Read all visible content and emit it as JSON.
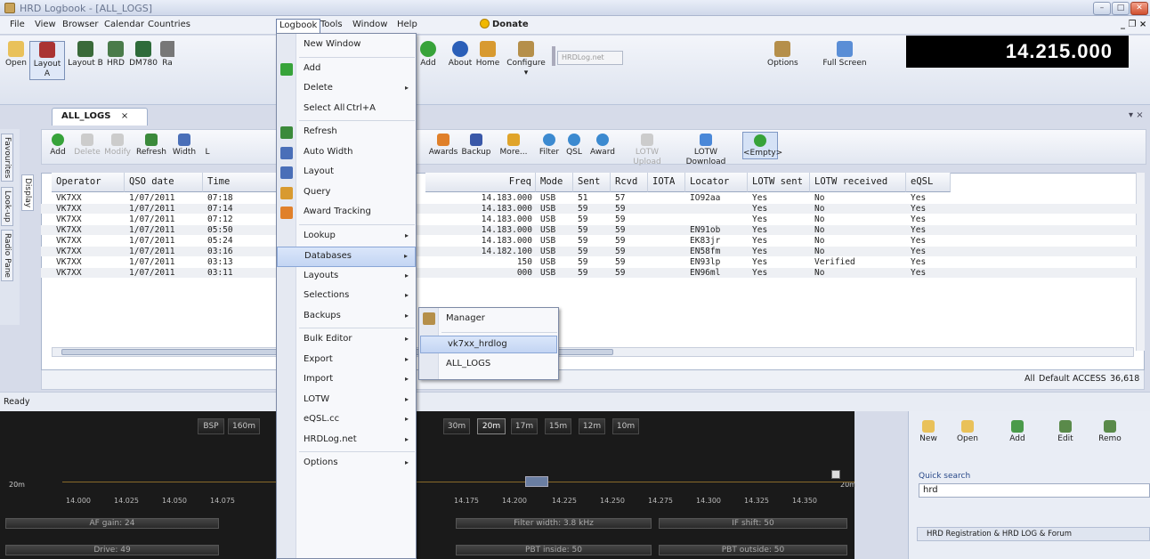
{
  "window": {
    "title": "HRD Logbook - [ALL_LOGS]",
    "min": "–",
    "max": "□",
    "close": "✕"
  },
  "menubar": {
    "items": [
      "File",
      "View",
      "Browser",
      "Calendar",
      "Countries",
      "Logbook",
      "Tools",
      "Window",
      "Help"
    ],
    "donate": "Donate",
    "mdi_controls": "_ ❐ ×"
  },
  "toolbar": {
    "buttons": [
      "Open",
      "Layout A",
      "Layout B",
      "HRD",
      "DM780",
      "Ra",
      "Add",
      "About",
      "Home",
      "Configure",
      "Options",
      "Full Screen"
    ],
    "hrdlog_placeholder": "HRDLog.net",
    "configure_arrow": "▾",
    "frequency": "14.215.000"
  },
  "document_tab": {
    "label": "ALL_LOGS",
    "close": "×",
    "right_controls": "▾ ×"
  },
  "side_tabs": [
    "Favourites",
    "Look-up",
    "Radio Pane"
  ],
  "display_tab": "Display",
  "inner_toolbar": {
    "buttons": [
      "Add",
      "Delete",
      "Modify",
      "Refresh",
      "Width",
      "L",
      "Awards",
      "Backup",
      "More...",
      "Filter",
      "QSL",
      "Award",
      "LOTW Upload",
      "LOTW Download",
      "<Empty>"
    ]
  },
  "grid": {
    "headers": [
      "Operator",
      "QSO date",
      "Time",
      "Freq",
      "Mode",
      "Sent",
      "Rcvd",
      "IOTA",
      "Locator",
      "LOTW sent",
      "LOTW received",
      "eQSL"
    ],
    "rows": [
      [
        "VK7XX",
        "1/07/2011",
        "07:18",
        "14.183.000",
        "USB",
        "51",
        "57",
        "",
        "IO92aa",
        "Yes",
        "No",
        "Yes"
      ],
      [
        "VK7XX",
        "1/07/2011",
        "07:14",
        "14.183.000",
        "USB",
        "59",
        "59",
        "",
        "",
        "Yes",
        "No",
        "Yes"
      ],
      [
        "VK7XX",
        "1/07/2011",
        "07:12",
        "14.183.000",
        "USB",
        "59",
        "59",
        "",
        "",
        "Yes",
        "No",
        "Yes"
      ],
      [
        "VK7XX",
        "1/07/2011",
        "05:50",
        "14.183.000",
        "USB",
        "59",
        "59",
        "",
        "EN91ob",
        "Yes",
        "No",
        "Yes"
      ],
      [
        "VK7XX",
        "1/07/2011",
        "05:24",
        "14.183.000",
        "USB",
        "59",
        "59",
        "",
        "EK83jr",
        "Yes",
        "No",
        "Yes"
      ],
      [
        "VK7XX",
        "1/07/2011",
        "03:16",
        "14.182.100",
        "USB",
        "59",
        "59",
        "",
        "EN58fm",
        "Yes",
        "No",
        "Yes"
      ],
      [
        "VK7XX",
        "1/07/2011",
        "03:13",
        "150",
        "USB",
        "59",
        "59",
        "",
        "EN93lp",
        "Yes",
        "Verified",
        "Yes"
      ],
      [
        "VK7XX",
        "1/07/2011",
        "03:11",
        "000",
        "USB",
        "59",
        "59",
        "",
        "EN96ml",
        "Yes",
        "No",
        "Yes"
      ]
    ],
    "status": {
      "all": "All",
      "default": "Default",
      "access": "ACCESS",
      "count": "36,618"
    }
  },
  "statusbar": {
    "text": "Ready"
  },
  "bandscope": {
    "bsp": "BSP",
    "bands_left": [
      "160m"
    ],
    "bands_right": [
      "30m",
      "20m",
      "17m",
      "15m",
      "12m",
      "10m"
    ],
    "band_label_left": "20m",
    "band_label_right": "20m",
    "scale_left": [
      "14.000",
      "14.025",
      "14.050",
      "14.075"
    ],
    "scale_right": [
      "14.175",
      "14.200",
      "14.225",
      "14.250",
      "14.275",
      "14.300",
      "14.325",
      "14.350"
    ],
    "sliders": [
      "AF gain: 24",
      "Filter width: 3.8 kHz",
      "IF shift: 50",
      "Drive: 49",
      "PBT inside: 50",
      "PBT outside: 50"
    ]
  },
  "right_panel": {
    "buttons": [
      "New",
      "Open",
      "Add",
      "Edit",
      "Remo"
    ],
    "quick_search_label": "Quick search",
    "quick_search_value": "hrd",
    "link": "HRD Registration & HRD LOG & Forum"
  },
  "logbook_menu": {
    "items": [
      {
        "label": "New Window",
        "arrow": ""
      },
      {
        "label": "Add",
        "arrow": ""
      },
      {
        "label": "Delete",
        "arrow": "▸"
      },
      {
        "label": "Select All",
        "shortcut": "Ctrl+A",
        "arrow": ""
      },
      {
        "label": "Refresh",
        "arrow": ""
      },
      {
        "label": "Auto Width",
        "arrow": ""
      },
      {
        "label": "Layout",
        "arrow": ""
      },
      {
        "label": "Query",
        "arrow": ""
      },
      {
        "label": "Award Tracking",
        "arrow": ""
      },
      {
        "label": "Lookup",
        "arrow": "▸"
      },
      {
        "label": "Databases",
        "arrow": "▸"
      },
      {
        "label": "Layouts",
        "arrow": "▸"
      },
      {
        "label": "Selections",
        "arrow": "▸"
      },
      {
        "label": "Backups",
        "arrow": "▸"
      },
      {
        "label": "Bulk Editor",
        "arrow": "▸"
      },
      {
        "label": "Export",
        "arrow": "▸"
      },
      {
        "label": "Import",
        "arrow": "▸"
      },
      {
        "label": "LOTW",
        "arrow": "▸"
      },
      {
        "label": "eQSL.cc",
        "arrow": "▸"
      },
      {
        "label": "HRDLog.net",
        "arrow": "▸"
      },
      {
        "label": "Options",
        "arrow": "▸"
      }
    ]
  },
  "databases_submenu": {
    "items": [
      "Manager",
      "vk7xx_hrdlog",
      "ALL_LOGS"
    ]
  }
}
